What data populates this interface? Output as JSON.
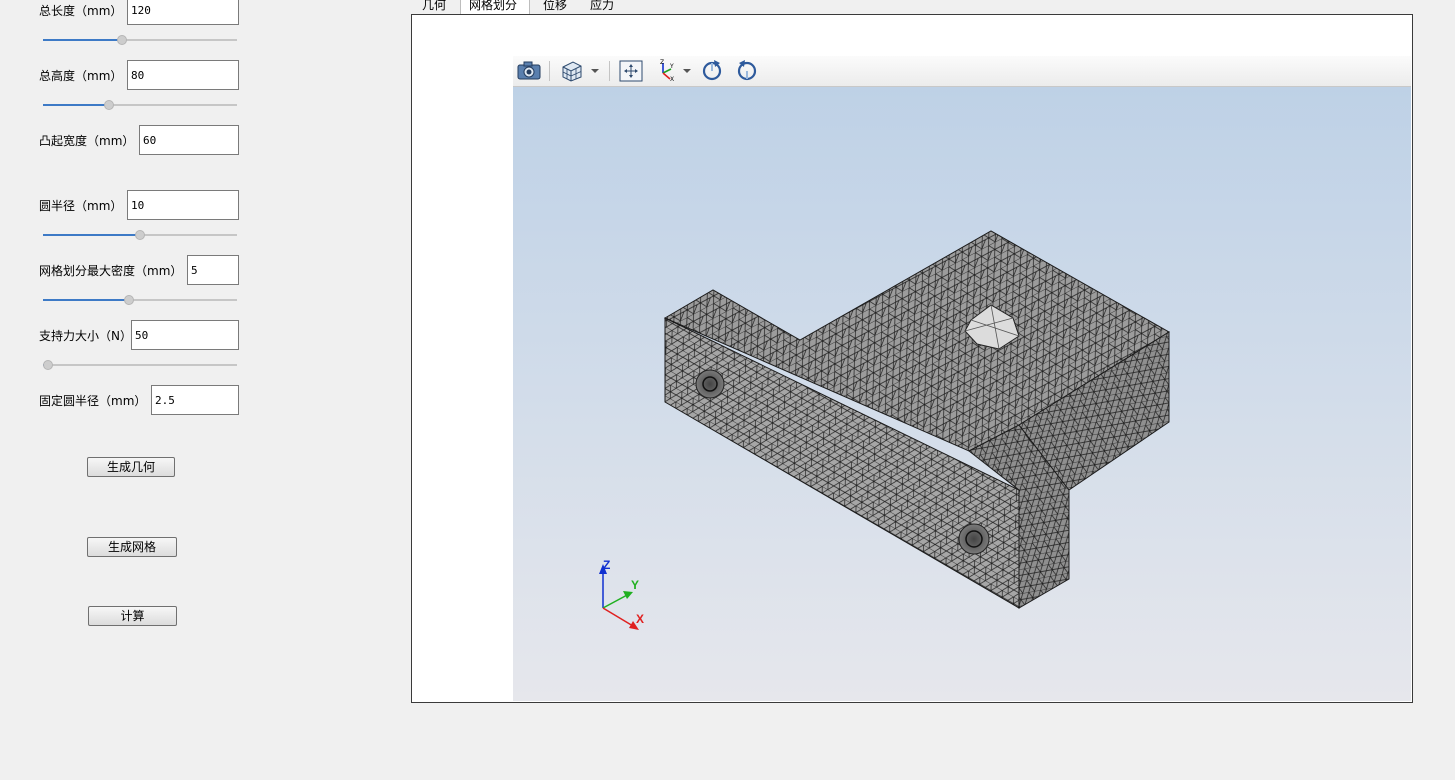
{
  "params": {
    "length": {
      "label": "总长度（mm）",
      "value": "120",
      "slider_fraction": 0.4
    },
    "height": {
      "label": "总高度（mm）",
      "value": "80",
      "slider_fraction": 0.33
    },
    "boss_width": {
      "label": "凸起宽度（mm）",
      "value": "60"
    },
    "radius": {
      "label": "圆半径（mm）",
      "value": "10",
      "slider_fraction": 0.5
    },
    "mesh_density": {
      "label": "网格划分最大密度（mm）",
      "value": "5",
      "slider_fraction": 0.44
    },
    "support_force": {
      "label": "支持力大小（N）",
      "value": "50",
      "slider_fraction": 0.0
    },
    "fix_radius": {
      "label": "固定圆半径（mm）",
      "value": "2.5"
    }
  },
  "buttons": {
    "gen_geometry": "生成几何",
    "gen_mesh": "生成网格",
    "compute": "计算"
  },
  "tabs": [
    {
      "label": "几何",
      "active": false
    },
    {
      "label": "网格划分",
      "active": true
    },
    {
      "label": "位移",
      "active": false
    },
    {
      "label": "应力",
      "active": false
    }
  ],
  "viewer": {
    "toolbar_icons": [
      "camera-icon",
      "view-cube-icon",
      "fit-all-icon",
      "axes-view-icon",
      "rotate-cw-icon",
      "rotate-ccw-icon"
    ],
    "triad": {
      "x": "X",
      "y": "Y",
      "z": "Z"
    },
    "colors": {
      "x": "#e02020",
      "y": "#20b020",
      "z": "#1030d0",
      "mesh_fill": "#9c9c9c",
      "mesh_line": "#1a1a1a"
    }
  }
}
